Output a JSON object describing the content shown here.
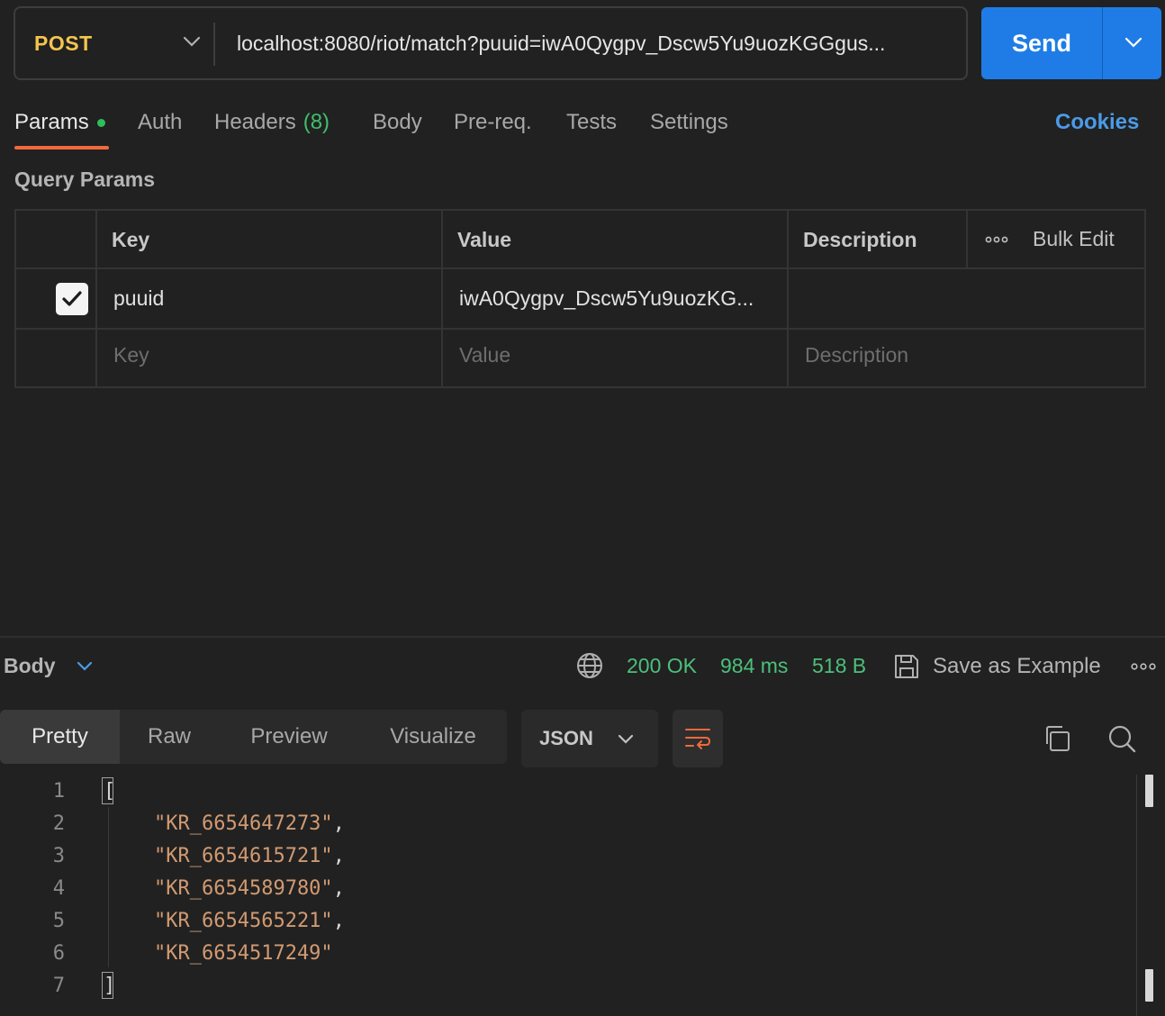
{
  "request": {
    "method": "POST",
    "url": "localhost:8080/riot/match?puuid=iwA0Qygpv_Dscw5Yu9uozKGGgus...",
    "send_label": "Send"
  },
  "tabs": {
    "params": "Params",
    "auth": "Auth",
    "headers": "Headers",
    "headers_count": "(8)",
    "body": "Body",
    "prereq": "Pre-req.",
    "tests": "Tests",
    "settings": "Settings",
    "cookies": "Cookies"
  },
  "query_params": {
    "title": "Query Params",
    "headers": {
      "key": "Key",
      "value": "Value",
      "description": "Description",
      "bulk_edit": "Bulk Edit"
    },
    "rows": [
      {
        "checked": true,
        "key": "puuid",
        "value": "iwA0Qygpv_Dscw5Yu9uozKG...",
        "description": ""
      }
    ],
    "placeholders": {
      "key": "Key",
      "value": "Value",
      "description": "Description"
    }
  },
  "response": {
    "section_label": "Body",
    "status": "200 OK",
    "time": "984 ms",
    "size": "518 B",
    "save_label": "Save as Example",
    "view_tabs": [
      "Pretty",
      "Raw",
      "Preview",
      "Visualize"
    ],
    "active_view": "Pretty",
    "format": "JSON",
    "line_numbers": [
      "1",
      "2",
      "3",
      "4",
      "5",
      "6",
      "7"
    ],
    "open_bracket": "[",
    "close_bracket": "]",
    "items": [
      "\"KR_6654647273\"",
      "\"KR_6654615721\"",
      "\"KR_6654589780\"",
      "\"KR_6654565221\"",
      "\"KR_6654517249\""
    ]
  },
  "colors": {
    "method": "#f4c54d",
    "send": "#1f7ce6",
    "accent_underline": "#f06a3c",
    "status_ok": "#4cc07a",
    "link": "#4a9be8",
    "string": "#d19a72"
  }
}
